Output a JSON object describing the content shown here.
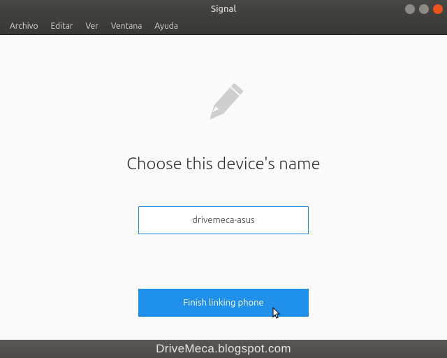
{
  "window": {
    "title": "Signal"
  },
  "menu": {
    "items": [
      "Archivo",
      "Editar",
      "Ver",
      "Ventana",
      "Ayuda"
    ]
  },
  "content": {
    "heading": "Choose this device's name",
    "device_name": "drivemeca-asus",
    "finish_button": "Finish linking phone"
  },
  "footer": {
    "text": "DriveMeca.blogspot.com"
  },
  "colors": {
    "accent": "#2090ea",
    "close_button": "#e95420"
  }
}
